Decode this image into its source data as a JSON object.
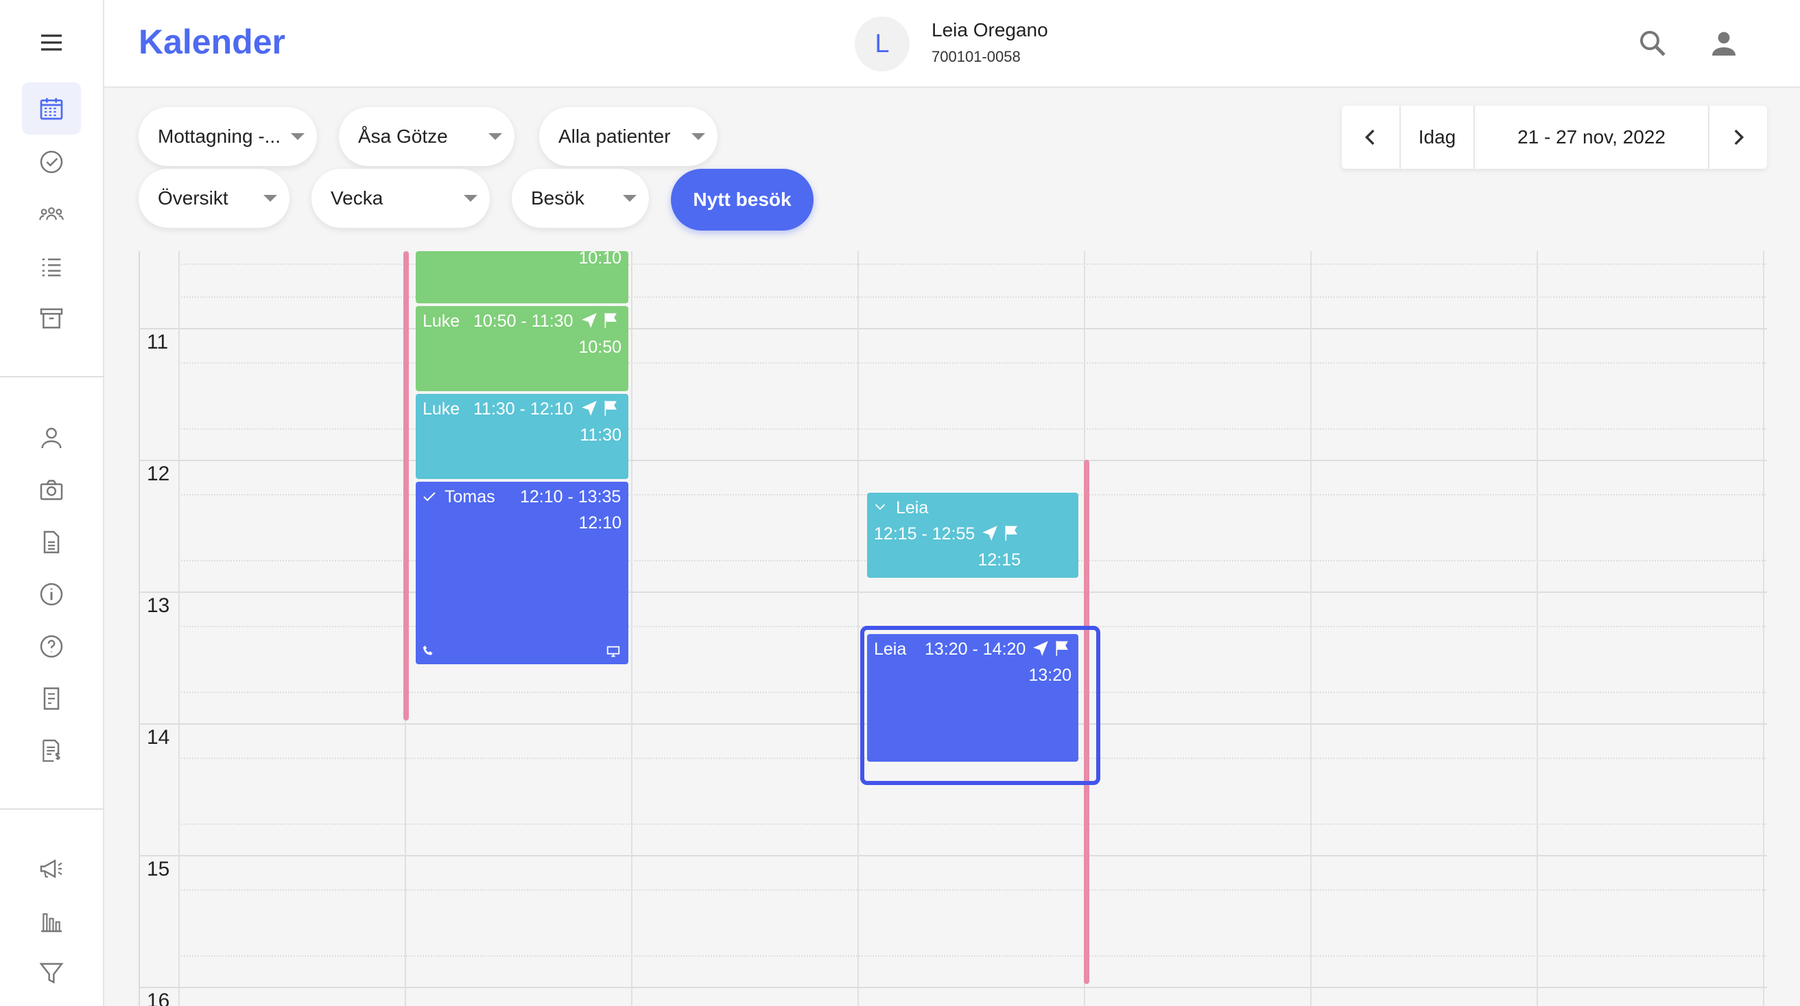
{
  "app": {
    "title": "Kalender"
  },
  "patient": {
    "initial": "L",
    "name": "Leia Oregano",
    "id": "700101-0058"
  },
  "filters": {
    "reception": "Mottagning -...",
    "practitioner": "Åsa Götze",
    "patients": "Alla patienter",
    "view": "Översikt",
    "period": "Vecka",
    "type": "Besök"
  },
  "actions": {
    "new_visit": "Nytt besök"
  },
  "date_nav": {
    "today": "Idag",
    "range": "21 - 27 nov, 2022"
  },
  "hours": [
    "11",
    "12",
    "13",
    "14",
    "15",
    "16"
  ],
  "events": {
    "e0": {
      "start": "10:10"
    },
    "e1": {
      "name": "Luke",
      "time": "10:50 - 11:30",
      "start": "10:50"
    },
    "e2": {
      "name": "Luke",
      "time": "11:30 - 12:10",
      "start": "11:30"
    },
    "e3": {
      "name": "Tomas",
      "time": "12:10 - 13:35",
      "start": "12:10"
    },
    "e4": {
      "name": "Leia",
      "time": "12:15 - 12:55",
      "start": "12:15"
    },
    "e5": {
      "name": "Leia",
      "time": "13:20 - 14:20",
      "start": "13:20"
    }
  },
  "colors": {
    "accent": "#4e6af1",
    "green": "#80cf7a",
    "teal": "#5bc4d6",
    "blue": "#5069f0",
    "now": "#e88ca8"
  }
}
